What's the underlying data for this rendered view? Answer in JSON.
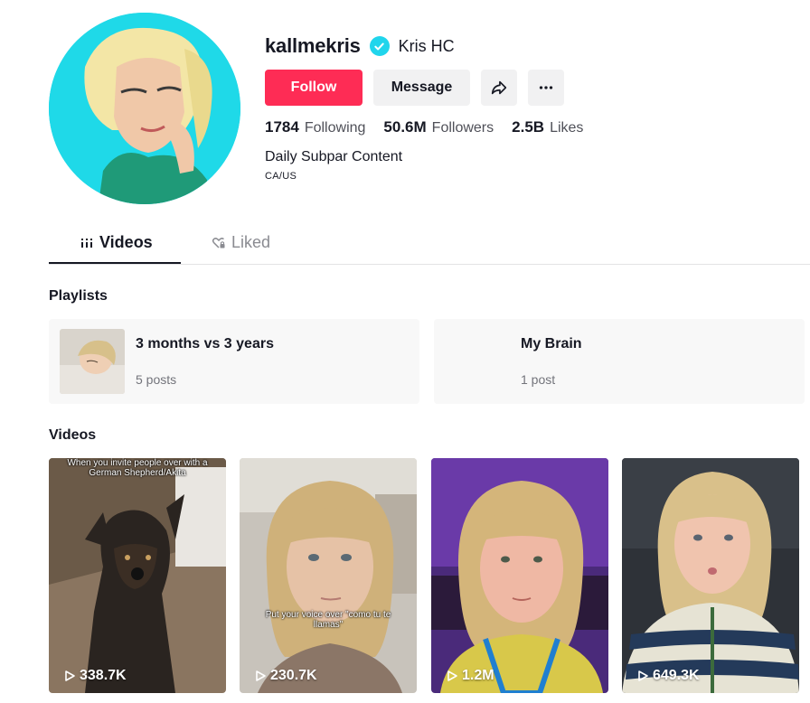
{
  "profile": {
    "username": "kallmekris",
    "nickname": "Kris HC",
    "verified_icon": "verified-badge-icon",
    "bio": "Daily Subpar Content",
    "region": "CA/US",
    "stats": [
      {
        "value": "1784",
        "label": "Following"
      },
      {
        "value": "50.6M",
        "label": "Followers"
      },
      {
        "value": "2.5B",
        "label": "Likes"
      }
    ]
  },
  "actions": {
    "follow_label": "Follow",
    "message_label": "Message",
    "share_icon": "share-icon",
    "more_icon": "more-icon"
  },
  "tabs": [
    {
      "label": "Videos",
      "icon": "grid-icon",
      "active": true
    },
    {
      "label": "Liked",
      "icon": "heart-lock-icon",
      "active": false
    }
  ],
  "playlists": {
    "title": "Playlists",
    "items": [
      {
        "title": "3 months vs 3 years",
        "count": "5 posts"
      },
      {
        "title": "My Brain",
        "count": "1 post"
      }
    ]
  },
  "videos": {
    "title": "Videos",
    "items": [
      {
        "views": "338.7K",
        "caption": "When you invite people over with a German Shepherd/Akita"
      },
      {
        "views": "230.7K",
        "caption": "Put your voice over \"como tu te llamas\""
      },
      {
        "views": "1.2M",
        "caption": ""
      },
      {
        "views": "649.3K",
        "caption": ""
      }
    ]
  },
  "colors": {
    "accent": "#fe2c55",
    "verified": "#20d5ec",
    "avatar_bg": "#1fd9e8"
  }
}
